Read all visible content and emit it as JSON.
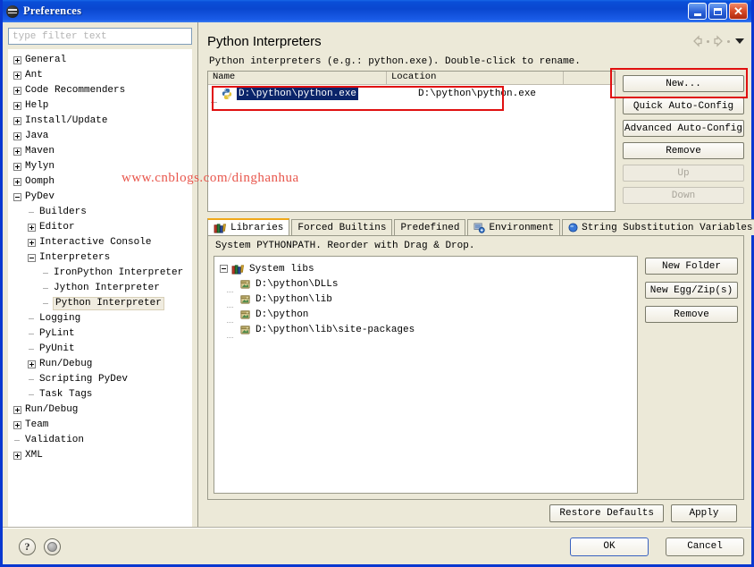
{
  "window": {
    "title": "Preferences",
    "icon": "preferences-icon",
    "controls": {
      "minimize": "minimize-button",
      "maximize": "maximize-button",
      "close": "close-button"
    },
    "titlebar_color": "#0a47d0",
    "dialog_bg": "#ece9d8"
  },
  "sidebar": {
    "filter": {
      "placeholder": "type filter text",
      "value": ""
    },
    "items": [
      {
        "label": "General",
        "indent": 0,
        "state": "collapsed"
      },
      {
        "label": "Ant",
        "indent": 0,
        "state": "collapsed"
      },
      {
        "label": "Code Recommenders",
        "indent": 0,
        "state": "collapsed"
      },
      {
        "label": "Help",
        "indent": 0,
        "state": "collapsed"
      },
      {
        "label": "Install/Update",
        "indent": 0,
        "state": "collapsed"
      },
      {
        "label": "Java",
        "indent": 0,
        "state": "collapsed"
      },
      {
        "label": "Maven",
        "indent": 0,
        "state": "collapsed"
      },
      {
        "label": "Mylyn",
        "indent": 0,
        "state": "collapsed"
      },
      {
        "label": "Oomph",
        "indent": 0,
        "state": "collapsed"
      },
      {
        "label": "PyDev",
        "indent": 0,
        "state": "expanded"
      },
      {
        "label": "Builders",
        "indent": 1,
        "state": "leaf"
      },
      {
        "label": "Editor",
        "indent": 1,
        "state": "collapsed"
      },
      {
        "label": "Interactive Console",
        "indent": 1,
        "state": "collapsed"
      },
      {
        "label": "Interpreters",
        "indent": 1,
        "state": "expanded"
      },
      {
        "label": "IronPython Interpreter",
        "indent": 2,
        "state": "leaf"
      },
      {
        "label": "Jython Interpreter",
        "indent": 2,
        "state": "leaf"
      },
      {
        "label": "Python Interpreter",
        "indent": 2,
        "state": "leaf",
        "selected": true
      },
      {
        "label": "Logging",
        "indent": 1,
        "state": "leaf"
      },
      {
        "label": "PyLint",
        "indent": 1,
        "state": "leaf"
      },
      {
        "label": "PyUnit",
        "indent": 1,
        "state": "leaf"
      },
      {
        "label": "Run/Debug",
        "indent": 1,
        "state": "collapsed"
      },
      {
        "label": "Scripting PyDev",
        "indent": 1,
        "state": "leaf"
      },
      {
        "label": "Task Tags",
        "indent": 1,
        "state": "leaf"
      },
      {
        "label": "Run/Debug",
        "indent": 0,
        "state": "collapsed"
      },
      {
        "label": "Team",
        "indent": 0,
        "state": "collapsed"
      },
      {
        "label": "Validation",
        "indent": 0,
        "state": "leaf"
      },
      {
        "label": "XML",
        "indent": 0,
        "state": "collapsed"
      }
    ]
  },
  "page": {
    "title": "Python Interpreters",
    "nav": {
      "back": "back-arrow-icon",
      "forward": "forward-arrow-icon",
      "menu": "dropdown-caret-icon"
    },
    "hint": "Python interpreters (e.g.: python.exe).   Double-click to rename.",
    "table": {
      "columns": [
        "Name",
        "Location",
        ""
      ],
      "rows": [
        {
          "name": "D:\\python\\python.exe",
          "location": "D:\\python\\python.exe",
          "selected": true,
          "icon": "python-icon"
        }
      ]
    },
    "side_buttons": [
      {
        "label": "New...",
        "enabled": true,
        "mnemonic": "w",
        "highlighted": true
      },
      {
        "label": "Quick Auto-Config",
        "enabled": true
      },
      {
        "label": "Advanced Auto-Config",
        "enabled": true
      },
      {
        "label": "Remove",
        "enabled": true,
        "mnemonic": "R"
      },
      {
        "label": "Up",
        "enabled": false
      },
      {
        "label": "Down",
        "enabled": false
      }
    ],
    "tabs": [
      {
        "label": "Libraries",
        "icon": "libraries-icon",
        "active": true
      },
      {
        "label": "Forced Builtins",
        "icon": "",
        "active": false
      },
      {
        "label": "Predefined",
        "icon": "",
        "active": false
      },
      {
        "label": "Environment",
        "icon": "environment-icon",
        "active": false
      },
      {
        "label": "String Substitution Variables",
        "icon": "sphere-icon",
        "active": false
      }
    ],
    "libraries": {
      "hint": "System PYTHONPATH.   Reorder with Drag & Drop.",
      "root": {
        "label": "System libs",
        "state": "expanded",
        "icon": "books-icon"
      },
      "entries": [
        {
          "label": "D:\\python\\DLLs",
          "icon": "jar-icon"
        },
        {
          "label": "D:\\python\\lib",
          "icon": "jar-icon"
        },
        {
          "label": "D:\\python",
          "icon": "jar-icon"
        },
        {
          "label": "D:\\python\\lib\\site-packages",
          "icon": "jar-icon"
        }
      ],
      "buttons": [
        {
          "label": "New Folder"
        },
        {
          "label": "New Egg/Zip(s)"
        },
        {
          "label": "Remove",
          "mnemonic": "R"
        }
      ]
    }
  },
  "footer": {
    "restore_defaults": "Restore Defaults",
    "apply": "Apply",
    "help_icon": "help-icon",
    "secondary_icon": "circle-icon",
    "ok": "OK",
    "cancel": "Cancel"
  },
  "watermark": {
    "text": "www.cnblogs.com/dinghanhua",
    "color": "#e8564c"
  }
}
